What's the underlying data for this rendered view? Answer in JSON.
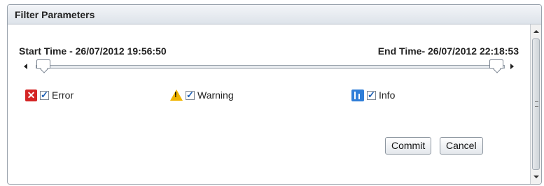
{
  "panel": {
    "title": "Filter Parameters"
  },
  "time_range": {
    "start_label": "Start Time - 26/07/2012 19:56:50",
    "end_label": "End Time- 26/07/2012 22:18:53",
    "start_fraction": 0.0,
    "end_fraction": 1.0
  },
  "filters": [
    {
      "label": "Error",
      "icon": "error-icon",
      "checked": true
    },
    {
      "label": "Warning",
      "icon": "warning-icon",
      "checked": true
    },
    {
      "label": "Info",
      "icon": "info-icon",
      "checked": true
    }
  ],
  "buttons": {
    "commit": "Commit",
    "cancel": "Cancel"
  },
  "colors": {
    "error": "#d42525",
    "warning": "#f0b400",
    "info": "#2f7ed8"
  }
}
